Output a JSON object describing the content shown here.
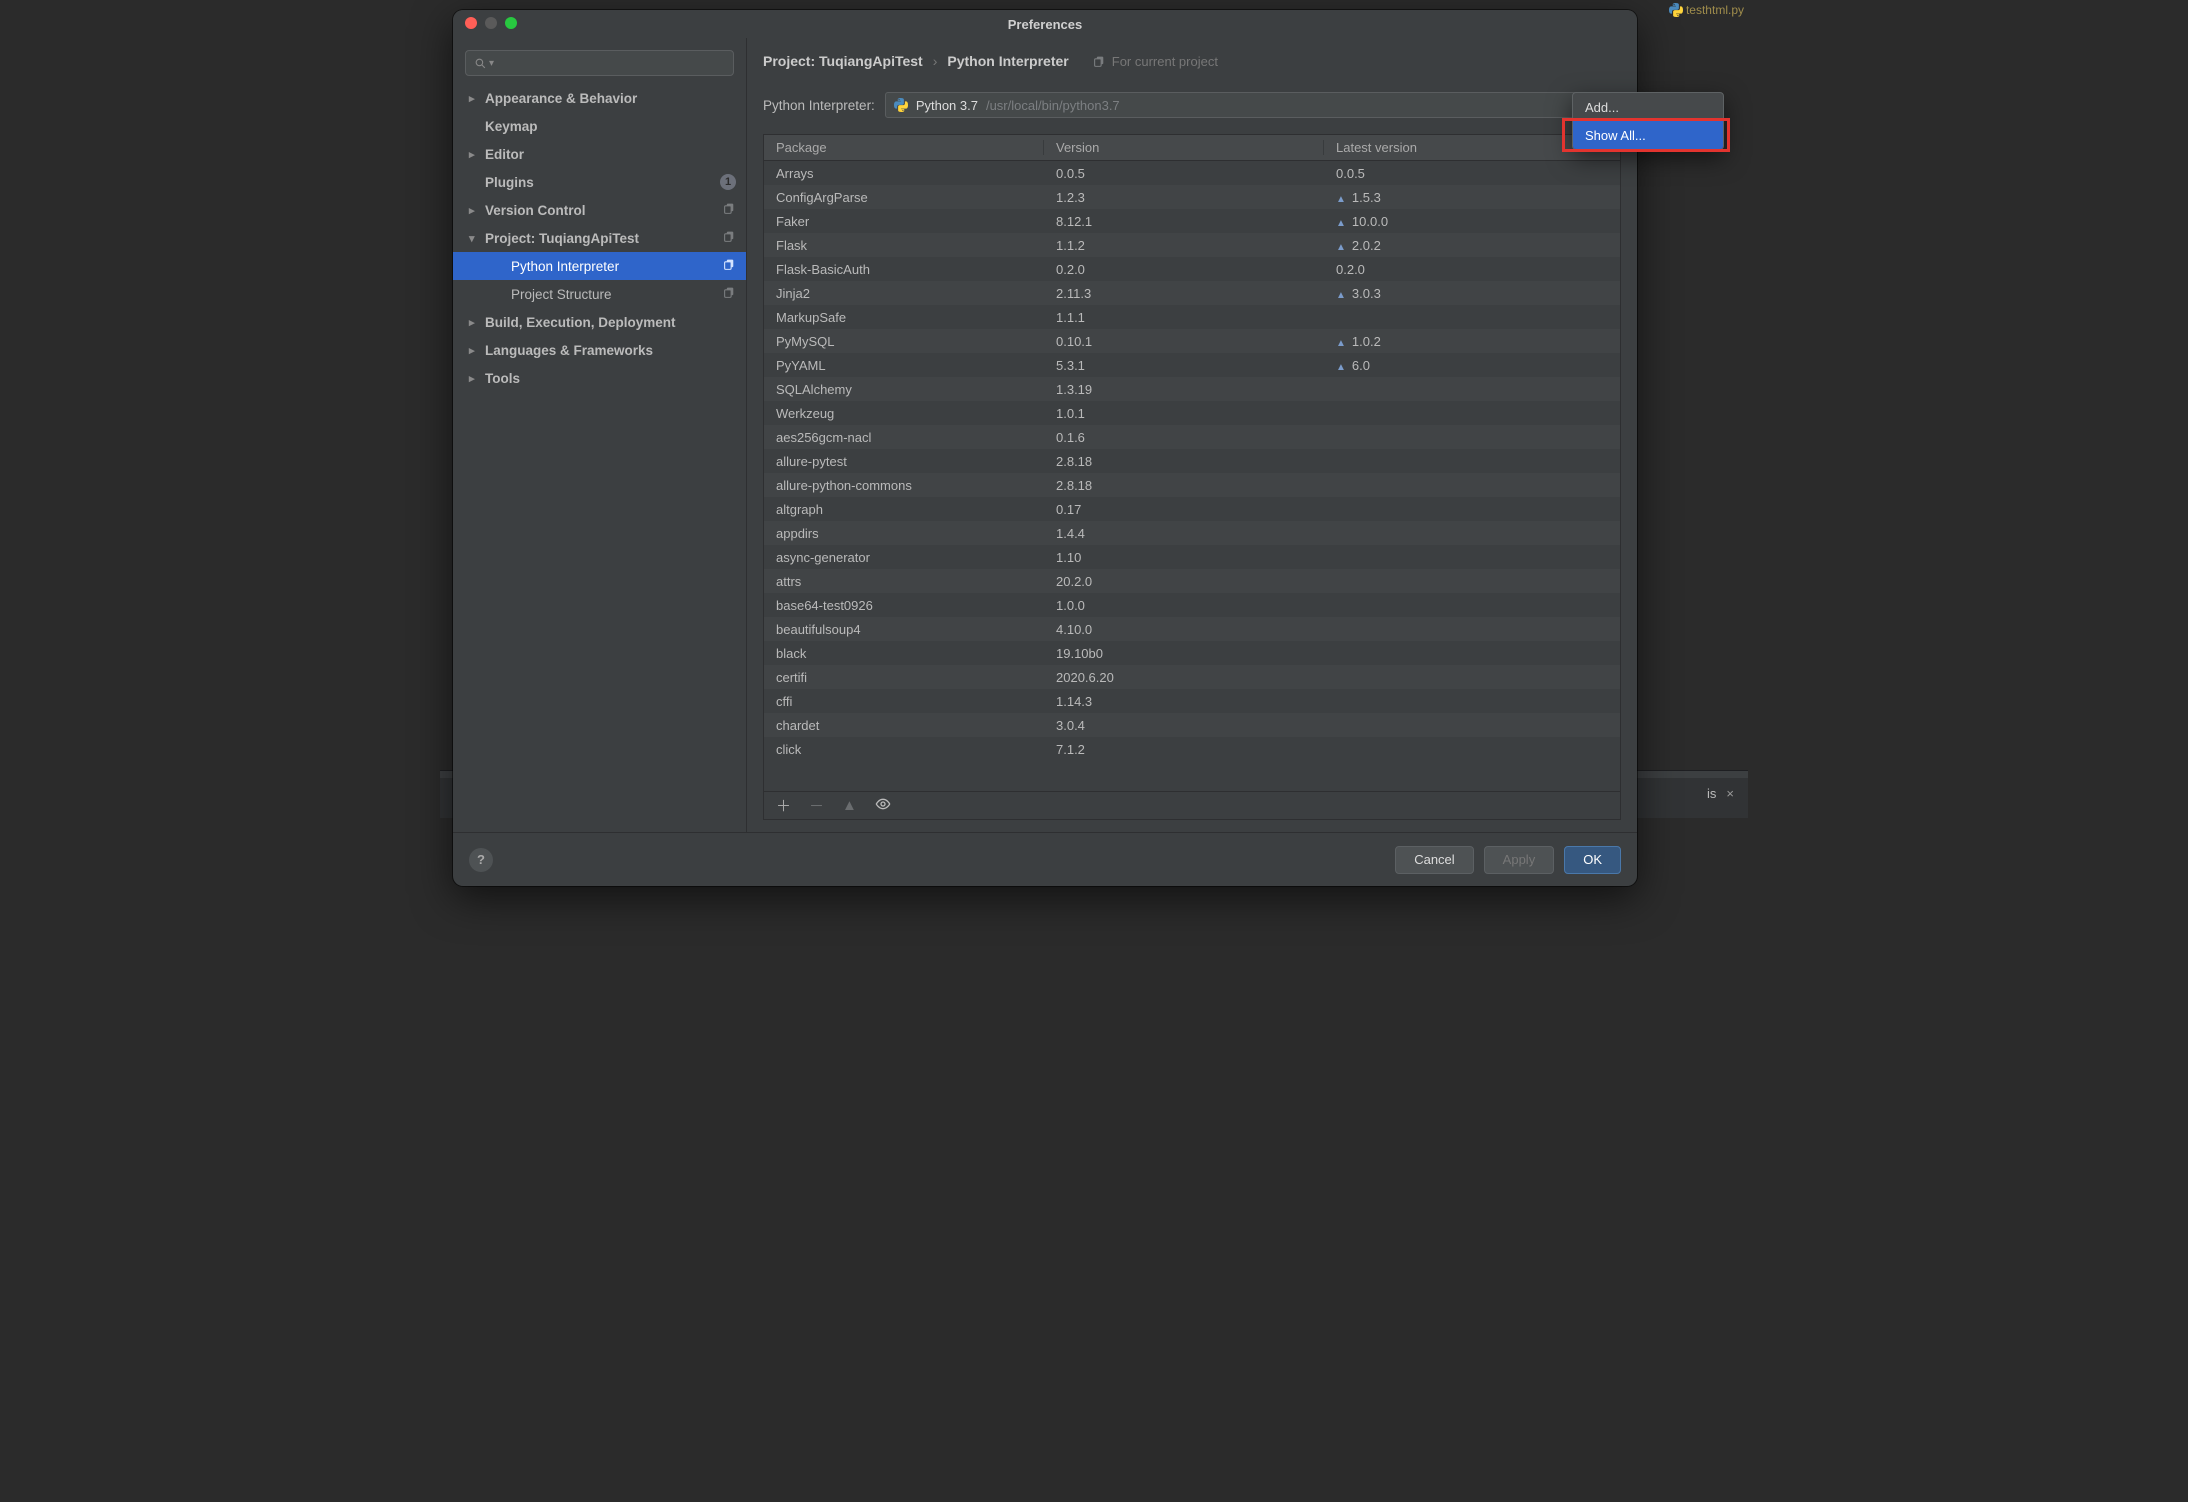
{
  "window": {
    "title": "Preferences"
  },
  "sidebar": {
    "search_placeholder": "",
    "items": [
      {
        "label": "Appearance & Behavior",
        "chev": "right",
        "bold": true
      },
      {
        "label": "Keymap",
        "chev": "none",
        "bold": true
      },
      {
        "label": "Editor",
        "chev": "right",
        "bold": true
      },
      {
        "label": "Plugins",
        "chev": "none",
        "bold": true,
        "badge": "1"
      },
      {
        "label": "Version Control",
        "chev": "right",
        "bold": true,
        "tail": "copy"
      },
      {
        "label": "Project: TuqiangApiTest",
        "chev": "down",
        "bold": true,
        "tail": "copy"
      },
      {
        "label": "Python Interpreter",
        "chev": "none",
        "child": true,
        "selected": true,
        "tail": "copy"
      },
      {
        "label": "Project Structure",
        "chev": "none",
        "child": true,
        "tail": "copy"
      },
      {
        "label": "Build, Execution, Deployment",
        "chev": "right",
        "bold": true
      },
      {
        "label": "Languages & Frameworks",
        "chev": "right",
        "bold": true
      },
      {
        "label": "Tools",
        "chev": "right",
        "bold": true
      }
    ]
  },
  "breadcrumb": {
    "a": "Project: TuqiangApiTest",
    "b": "Python Interpreter",
    "marker": "For current project"
  },
  "interpreter": {
    "label": "Python Interpreter:",
    "name": "Python 3.7",
    "path": "/usr/local/bin/python3.7"
  },
  "table": {
    "headers": {
      "c0": "Package",
      "c1": "Version",
      "c2": "Latest version"
    },
    "rows": [
      {
        "n": "Arrays",
        "v": "0.0.5",
        "lv": "0.0.5",
        "up": false
      },
      {
        "n": "ConfigArgParse",
        "v": "1.2.3",
        "lv": "1.5.3",
        "up": true
      },
      {
        "n": "Faker",
        "v": "8.12.1",
        "lv": "10.0.0",
        "up": true
      },
      {
        "n": "Flask",
        "v": "1.1.2",
        "lv": "2.0.2",
        "up": true
      },
      {
        "n": "Flask-BasicAuth",
        "v": "0.2.0",
        "lv": "0.2.0",
        "up": false
      },
      {
        "n": "Jinja2",
        "v": "2.11.3",
        "lv": "3.0.3",
        "up": true
      },
      {
        "n": "MarkupSafe",
        "v": "1.1.1",
        "lv": "",
        "up": false
      },
      {
        "n": "PyMySQL",
        "v": "0.10.1",
        "lv": "1.0.2",
        "up": true
      },
      {
        "n": "PyYAML",
        "v": "5.3.1",
        "lv": "6.0",
        "up": true
      },
      {
        "n": "SQLAlchemy",
        "v": "1.3.19",
        "lv": "",
        "up": false
      },
      {
        "n": "Werkzeug",
        "v": "1.0.1",
        "lv": "",
        "up": false
      },
      {
        "n": "aes256gcm-nacl",
        "v": "0.1.6",
        "lv": "",
        "up": false
      },
      {
        "n": "allure-pytest",
        "v": "2.8.18",
        "lv": "",
        "up": false
      },
      {
        "n": "allure-python-commons",
        "v": "2.8.18",
        "lv": "",
        "up": false
      },
      {
        "n": "altgraph",
        "v": "0.17",
        "lv": "",
        "up": false
      },
      {
        "n": "appdirs",
        "v": "1.4.4",
        "lv": "",
        "up": false
      },
      {
        "n": "async-generator",
        "v": "1.10",
        "lv": "",
        "up": false
      },
      {
        "n": "attrs",
        "v": "20.2.0",
        "lv": "",
        "up": false
      },
      {
        "n": "base64-test0926",
        "v": "1.0.0",
        "lv": "",
        "up": false
      },
      {
        "n": "beautifulsoup4",
        "v": "4.10.0",
        "lv": "",
        "up": false
      },
      {
        "n": "black",
        "v": "19.10b0",
        "lv": "",
        "up": false
      },
      {
        "n": "certifi",
        "v": "2020.6.20",
        "lv": "",
        "up": false
      },
      {
        "n": "cffi",
        "v": "1.14.3",
        "lv": "",
        "up": false
      },
      {
        "n": "chardet",
        "v": "3.0.4",
        "lv": "",
        "up": false
      },
      {
        "n": "click",
        "v": "7.1.2",
        "lv": "",
        "up": false
      }
    ]
  },
  "popup": {
    "add": "Add...",
    "show_all": "Show All..."
  },
  "buttons": {
    "cancel": "Cancel",
    "apply": "Apply",
    "ok": "OK"
  },
  "background": {
    "filetab": "testhtml.py",
    "bottom_chip": "is",
    "bottom_x": "×"
  }
}
